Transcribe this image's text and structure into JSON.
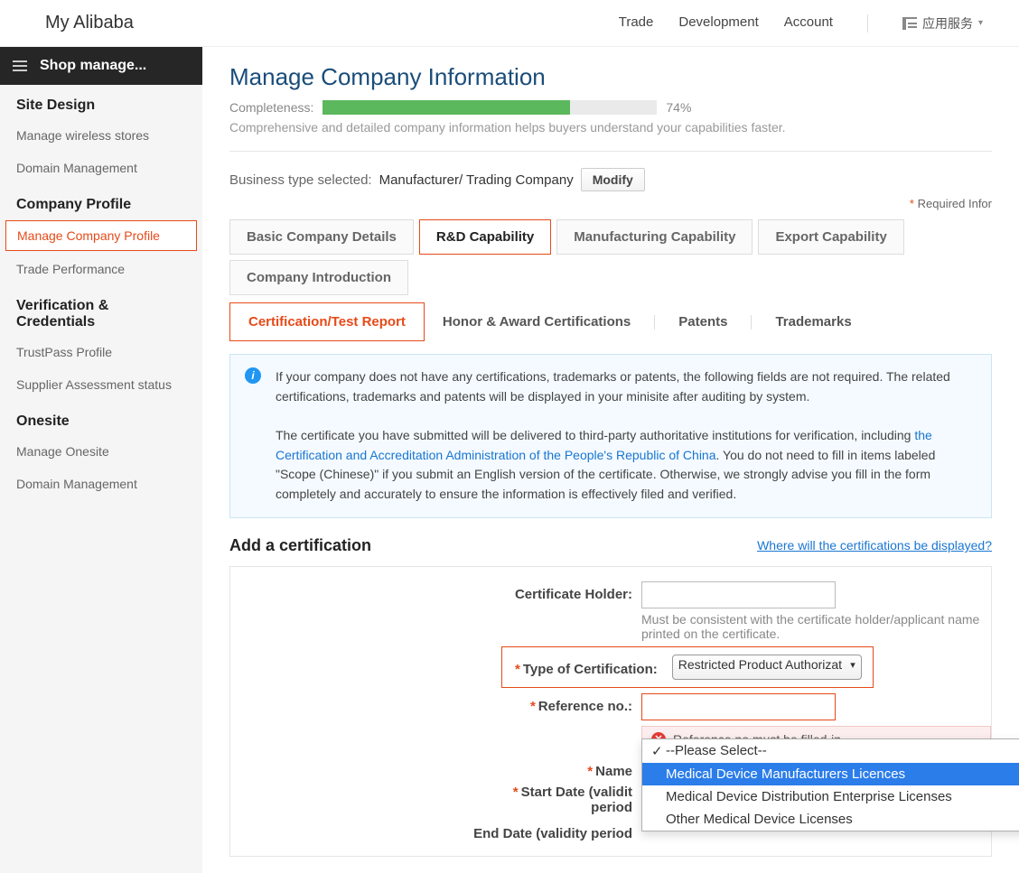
{
  "header": {
    "title": "My Alibaba",
    "nav": [
      "Trade",
      "Development",
      "Account"
    ],
    "app_services": "应用服务"
  },
  "sidebar": {
    "head": "Shop manage...",
    "sections": [
      {
        "title": "Site Design",
        "items": [
          "Manage wireless stores",
          "Domain Management"
        ]
      },
      {
        "title": "Company Profile",
        "items": [
          "Manage Company Profile",
          "Trade Performance"
        ],
        "activeIndex": 0
      },
      {
        "title": "Verification & Credentials",
        "items": [
          "TrustPass Profile",
          "Supplier Assessment status"
        ]
      },
      {
        "title": "Onesite",
        "items": [
          "Manage Onesite",
          "Domain Management"
        ]
      }
    ]
  },
  "page": {
    "title": "Manage Company Information",
    "completeness_label": "Completeness:",
    "completeness_pct": "74%",
    "completeness_value": 74,
    "subtext": "Comprehensive and detailed company information helps buyers understand your capabilities faster.",
    "biz_label": "Business type selected:",
    "biz_value": "Manufacturer/ Trading Company",
    "modify": "Modify",
    "required_note": "Required Infor"
  },
  "tabs": [
    "Basic Company Details",
    "R&D Capability",
    "Manufacturing Capability",
    "Export Capability",
    "Company Introduction"
  ],
  "active_tab": 1,
  "subtabs": [
    "Certification/Test Report",
    "Honor & Award Certifications",
    "Patents",
    "Trademarks"
  ],
  "active_subtab": 0,
  "infobox": {
    "p1": "If your company does not have any certifications, trademarks or patents, the following fields are not required. The related certifications, trademarks and patents will be displayed in your minisite after auditing by system.",
    "p2a": "The certificate you have submitted will be delivered to third-party authoritative institutions for verification, including ",
    "link": "the Certification and Accreditation Administration of the People's Republic of China",
    "p2b": ". You do not need to fill in items labeled \"Scope (Chinese)\" if you submit an English version of the certificate. Otherwise, we strongly advise you fill in the form completely and accurately to ensure the information is effectively filed and verified."
  },
  "section": {
    "title": "Add a certification",
    "link": "Where will the certifications be displayed?"
  },
  "form": {
    "cert_holder_label": "Certificate Holder:",
    "cert_holder_help": "Must be consistent with the certificate holder/applicant name printed on the certificate.",
    "type_label": "Type of Certification:",
    "type_value": "Restricted Product Authorizat",
    "ref_label": "Reference no.:",
    "ref_error": "Reference no must be filled-in.",
    "name_label": "Name",
    "start_label": "Start Date (validit",
    "period_label": "period",
    "end_label": "End Date (validity period"
  },
  "dropdown": {
    "items": [
      "--Please Select--",
      "Medical Device Manufacturers Licences",
      "Medical Device Distribution Enterprise Licenses",
      "Other Medical Device Licenses"
    ],
    "checkedIndex": 0,
    "highlightedIndex": 1
  }
}
